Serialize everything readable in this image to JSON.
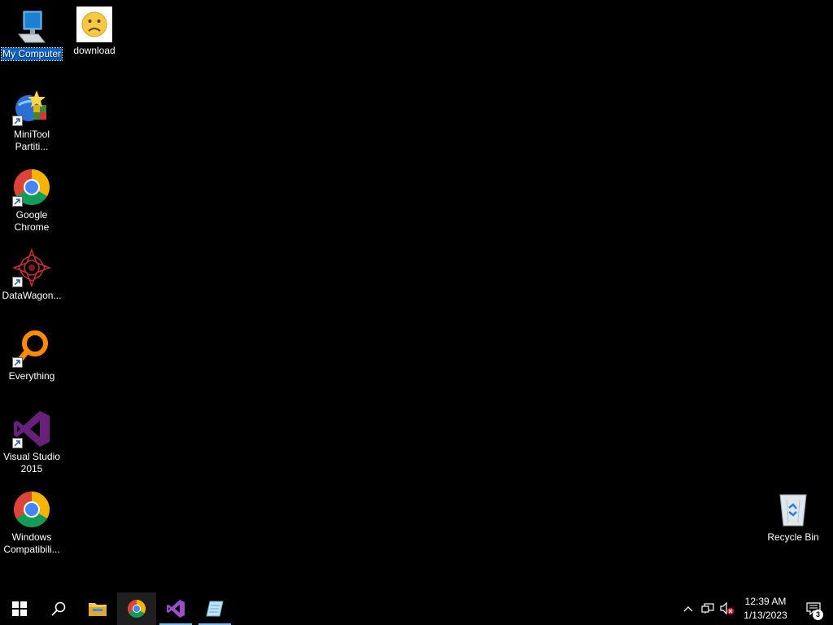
{
  "desktop": {
    "icons": [
      {
        "name": "My Computer",
        "selected": true
      },
      {
        "name": "download"
      },
      {
        "name": "MiniTool Partiti..."
      },
      {
        "name": "Google Chrome"
      },
      {
        "name": "DataWagon..."
      },
      {
        "name": "Everything"
      },
      {
        "name": "Visual Studio 2015"
      },
      {
        "name": "Windows Compatibili..."
      },
      {
        "name": "Recycle Bin"
      }
    ]
  },
  "taskbar": {
    "apps": [
      "start",
      "search",
      "file-explorer",
      "google-chrome",
      "visual-studio",
      "notepad-app"
    ],
    "clock": {
      "time": "12:39 AM",
      "date": "1/13/2023"
    },
    "notifications": {
      "count": "3"
    }
  },
  "colors": {
    "background": "#000000",
    "selection": "#0a64c8",
    "taskbar_accent": "#76b9ed"
  }
}
